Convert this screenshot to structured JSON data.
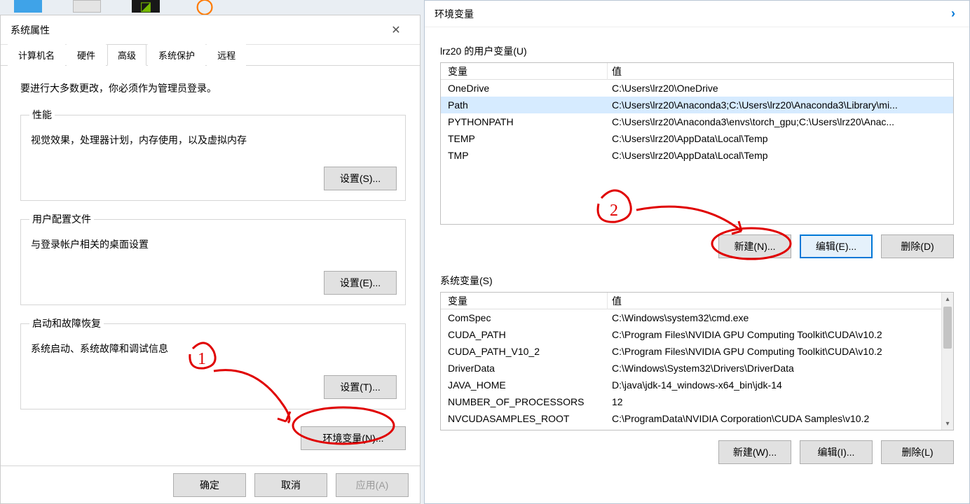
{
  "sysprop": {
    "title": "系统属性",
    "tabs": [
      "计算机名",
      "硬件",
      "高级",
      "系统保护",
      "远程"
    ],
    "active_tab": 2,
    "lead": "要进行大多数更改，你必须作为管理员登录。",
    "perf": {
      "legend": "性能",
      "desc": "视觉效果，处理器计划，内存使用，以及虚拟内存",
      "button": "设置(S)..."
    },
    "userprof": {
      "legend": "用户配置文件",
      "desc": "与登录帐户相关的桌面设置",
      "button": "设置(E)..."
    },
    "startup": {
      "legend": "启动和故障恢复",
      "desc": "系统启动、系统故障和调试信息",
      "button": "设置(T)..."
    },
    "envvars_button": "环境变量(N)...",
    "ok": "确定",
    "cancel": "取消",
    "apply": "应用(A)"
  },
  "envvars": {
    "title": "环境变量",
    "user_section_label": "lrz20 的用户变量(U)",
    "system_section_label": "系统变量(S)",
    "col_var": "变量",
    "col_val": "值",
    "user_vars": [
      {
        "name": "OneDrive",
        "value": "C:\\Users\\lrz20\\OneDrive"
      },
      {
        "name": "Path",
        "value": "C:\\Users\\lrz20\\Anaconda3;C:\\Users\\lrz20\\Anaconda3\\Library\\mi..."
      },
      {
        "name": "PYTHONPATH",
        "value": "C:\\Users\\lrz20\\Anaconda3\\envs\\torch_gpu;C:\\Users\\lrz20\\Anac..."
      },
      {
        "name": "TEMP",
        "value": "C:\\Users\\lrz20\\AppData\\Local\\Temp"
      },
      {
        "name": "TMP",
        "value": "C:\\Users\\lrz20\\AppData\\Local\\Temp"
      }
    ],
    "user_selected": 1,
    "system_vars": [
      {
        "name": "ComSpec",
        "value": "C:\\Windows\\system32\\cmd.exe"
      },
      {
        "name": "CUDA_PATH",
        "value": "C:\\Program Files\\NVIDIA GPU Computing Toolkit\\CUDA\\v10.2"
      },
      {
        "name": "CUDA_PATH_V10_2",
        "value": "C:\\Program Files\\NVIDIA GPU Computing Toolkit\\CUDA\\v10.2"
      },
      {
        "name": "DriverData",
        "value": "C:\\Windows\\System32\\Drivers\\DriverData"
      },
      {
        "name": "JAVA_HOME",
        "value": "D:\\java\\jdk-14_windows-x64_bin\\jdk-14"
      },
      {
        "name": "NUMBER_OF_PROCESSORS",
        "value": "12"
      },
      {
        "name": "NVCUDASAMPLES_ROOT",
        "value": "C:\\ProgramData\\NVIDIA Corporation\\CUDA Samples\\v10.2"
      }
    ],
    "user_buttons": {
      "new": "新建(N)...",
      "edit": "编辑(E)...",
      "delete": "删除(D)"
    },
    "system_buttons": {
      "new": "新建(W)...",
      "edit": "编辑(I)...",
      "delete": "删除(L)"
    }
  },
  "annotations": {
    "one": "1",
    "two": "2"
  },
  "colors": {
    "annotation": "#e00000",
    "accent": "#0078d7"
  }
}
